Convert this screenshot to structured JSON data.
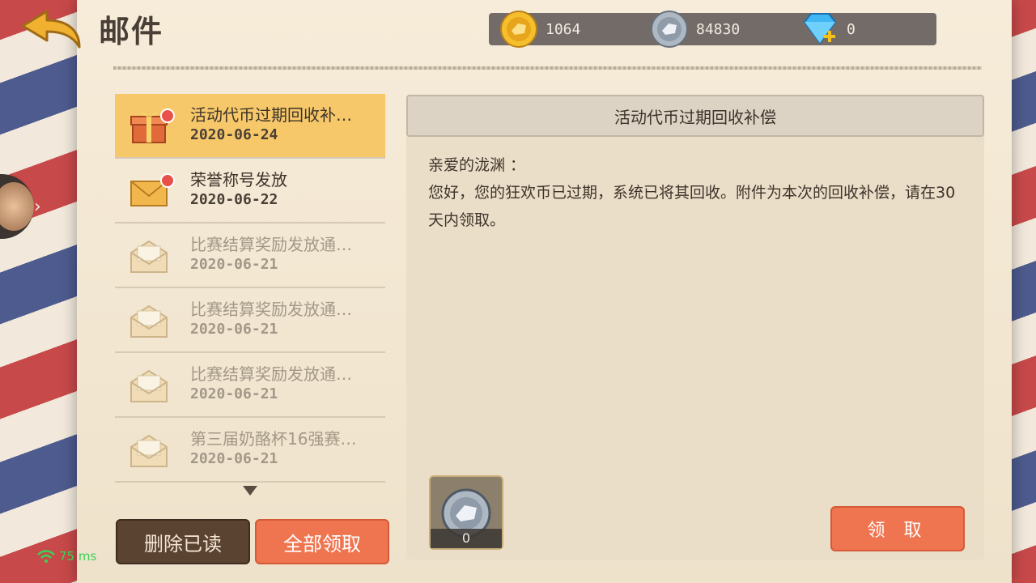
{
  "header": {
    "title": "邮件",
    "currencies": [
      {
        "name": "gold-coin",
        "value": "1064",
        "color": "#f0b429"
      },
      {
        "name": "silver-coin",
        "value": "84830",
        "color": "#b9c2cc"
      },
      {
        "name": "diamond",
        "value": "0",
        "color": "#39b4f0"
      }
    ]
  },
  "mails": [
    {
      "subject": "活动代币过期回收补…",
      "date": "2020-06-24",
      "icon": "gift-icon",
      "unread": true,
      "selected": true
    },
    {
      "subject": "荣誉称号发放",
      "date": "2020-06-22",
      "icon": "envelope-icon",
      "unread": true,
      "selected": false
    },
    {
      "subject": "比赛结算奖励发放通…",
      "date": "2020-06-21",
      "icon": "open-envelope-icon",
      "unread": false,
      "selected": false
    },
    {
      "subject": "比赛结算奖励发放通…",
      "date": "2020-06-21",
      "icon": "open-envelope-icon",
      "unread": false,
      "selected": false
    },
    {
      "subject": "比赛结算奖励发放通…",
      "date": "2020-06-21",
      "icon": "open-envelope-icon",
      "unread": false,
      "selected": false
    },
    {
      "subject": "第三届奶酪杯16强赛…",
      "date": "2020-06-21",
      "icon": "open-envelope-icon",
      "unread": false,
      "selected": false
    }
  ],
  "actions": {
    "delete_read": "删除已读",
    "claim_all": "全部领取"
  },
  "detail": {
    "title": "活动代币过期回收补偿",
    "greeting": "亲爱的泷渊 ：",
    "body": "您好，您的狂欢币已过期，系统已将其回收。附件为本次的回收补偿，请在30天内领取。",
    "attachment": {
      "icon": "silver-coin-icon",
      "count": "0"
    },
    "claim_label": "领 取"
  },
  "status": {
    "ping": "75 ms"
  }
}
